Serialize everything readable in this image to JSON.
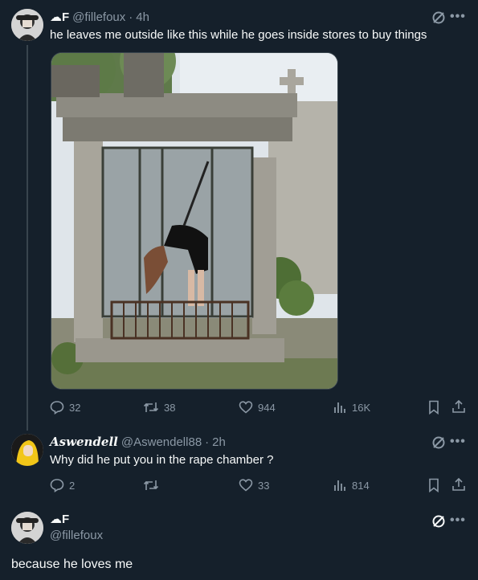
{
  "tweet1": {
    "display_name": "☁F",
    "handle": "@fillefoux",
    "separator": "·",
    "time": "4h",
    "text": "he leaves me outside like this while he goes inside stores to buy things",
    "replies": "32",
    "retweets": "38",
    "likes": "944",
    "views": "16K"
  },
  "reply1": {
    "display_name": "Aswendell",
    "handle": "@Aswendell88",
    "separator": "·",
    "time": "2h",
    "text": "Why did he put you in the rape chamber ?",
    "replies": "2",
    "retweets": "",
    "likes": "33",
    "views": "814"
  },
  "focused": {
    "display_name": "☁F",
    "handle": "@fillefoux",
    "text": "because he loves me"
  },
  "icons": {
    "more": "•••"
  },
  "colors": {
    "background": "#15202b",
    "text": "#f7f9f9",
    "muted": "#8b98a5",
    "divider": "#38444d"
  }
}
